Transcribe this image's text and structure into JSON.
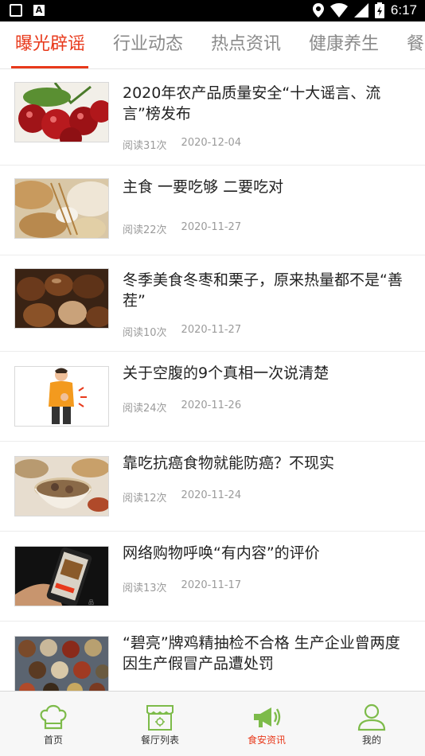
{
  "status_bar": {
    "time": "6:17"
  },
  "tabs": [
    {
      "label": "曝光辟谣",
      "active": true
    },
    {
      "label": "行业动态",
      "active": false
    },
    {
      "label": "热点资讯",
      "active": false
    },
    {
      "label": "健康养生",
      "active": false
    },
    {
      "label": "餐",
      "active": false
    }
  ],
  "articles": [
    {
      "title": "2020年农产品质量安全“十大谣言、流言”榜发布",
      "reads": "阅读31次",
      "date": "2020-12-04",
      "thumb": "cherries"
    },
    {
      "title": "主食 一要吃够 二要吃对",
      "reads": "阅读22次",
      "date": "2020-11-27",
      "thumb": "grains"
    },
    {
      "title": "冬季美食冬枣和栗子，原来热量都不是“善茬”",
      "reads": "阅读10次",
      "date": "2020-11-27",
      "thumb": "chestnuts"
    },
    {
      "title": "关于空腹的9个真相一次说清楚",
      "reads": "阅读24次",
      "date": "2020-11-26",
      "thumb": "stomach-ache"
    },
    {
      "title": "靠吃抗癌食物就能防癌？不现实",
      "reads": "阅读12次",
      "date": "2020-11-24",
      "thumb": "soup"
    },
    {
      "title": "网络购物呼唤“有内容”的评价",
      "reads": "阅读13次",
      "date": "2020-11-17",
      "thumb": "phone-shopping"
    },
    {
      "title": "“碧亮”牌鸡精抽检不合格 生产企业曾两度因生产假冒产品遭处罚",
      "reads": "",
      "date": "",
      "thumb": "spices"
    }
  ],
  "bottom_nav": [
    {
      "label": "首页",
      "icon": "chef-hat-icon",
      "active": false
    },
    {
      "label": "餐厅列表",
      "icon": "shop-icon",
      "active": false
    },
    {
      "label": "食安资讯",
      "icon": "megaphone-icon",
      "active": true
    },
    {
      "label": "我的",
      "icon": "user-icon",
      "active": false
    }
  ],
  "colors": {
    "accent": "#e8391b",
    "nav_green": "#7dbb4a"
  }
}
